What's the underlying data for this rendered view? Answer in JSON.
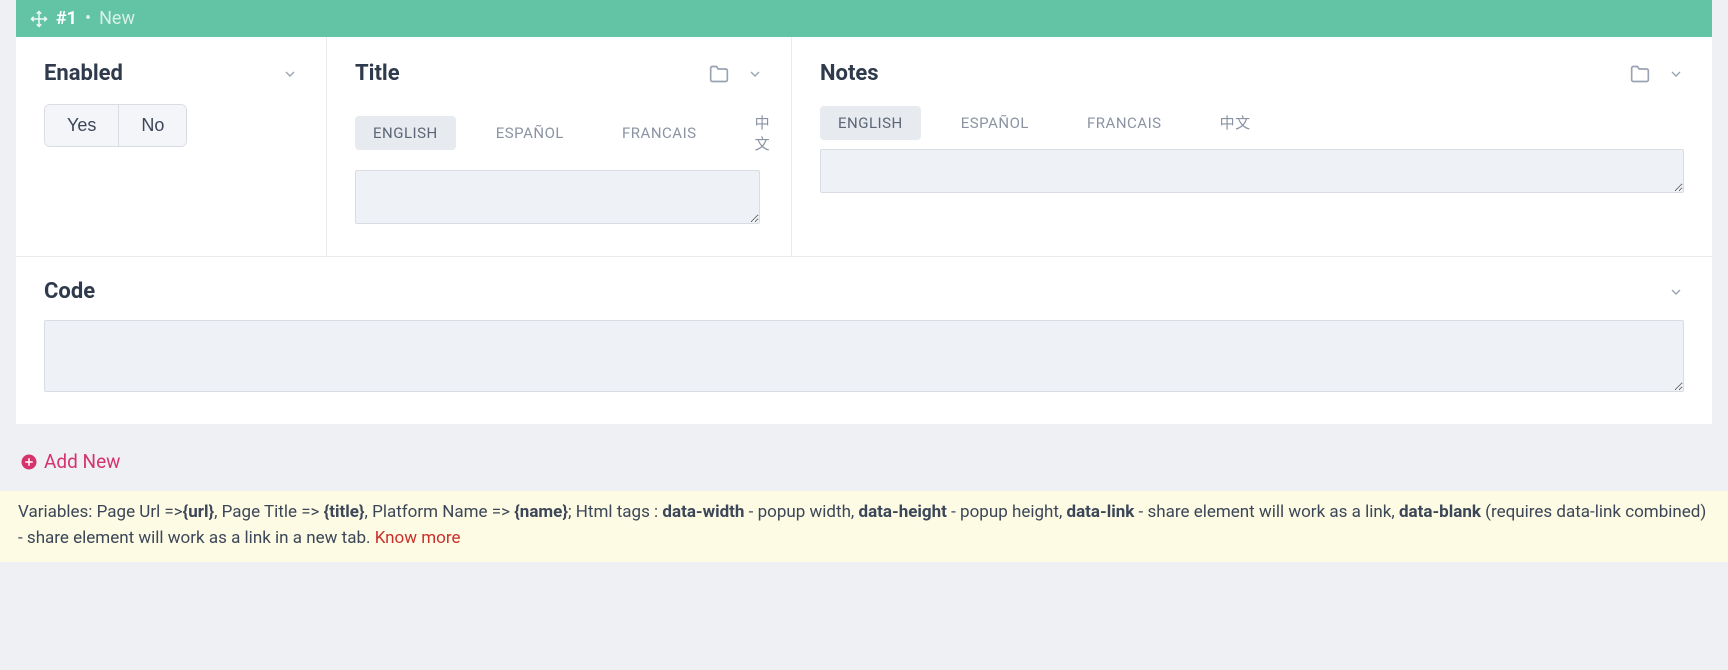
{
  "header": {
    "item_number": "#1",
    "status": "New"
  },
  "panels": {
    "enabled": {
      "title": "Enabled",
      "yes": "Yes",
      "no": "No"
    },
    "title": {
      "title": "Title",
      "langs": [
        "ENGLISH",
        "ESPAÑOL",
        "FRANCAIS",
        "中文"
      ],
      "active_lang_index": 0,
      "value": ""
    },
    "notes": {
      "title": "Notes",
      "langs": [
        "ENGLISH",
        "ESPAÑOL",
        "FRANCAIS",
        "中文"
      ],
      "active_lang_index": 0,
      "value": ""
    },
    "code": {
      "title": "Code",
      "value": ""
    }
  },
  "add_new_label": "Add New",
  "info": {
    "variables_label": "Variables:",
    "page_url_label": "Page Url =>",
    "page_url_var": "{url}",
    "page_title_label": ", Page Title => ",
    "page_title_var": "{title}",
    "platform_name_label": ", Platform Name => ",
    "platform_name_var": "{name}",
    "html_tags_label": "; Html tags : ",
    "data_width": "data-width",
    "data_width_desc": " - popup width, ",
    "data_height": "data-height",
    "data_height_desc": " - popup height, ",
    "data_link": "data-link",
    "data_link_desc": " - share element will work as a link, ",
    "data_blank": "data-blank",
    "data_blank_desc": " (requires data-link combined) - share element will work as a link in a new tab. ",
    "know_more": "Know more"
  }
}
